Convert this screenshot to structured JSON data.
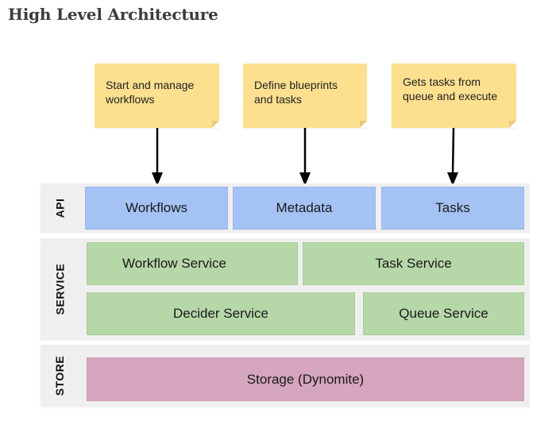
{
  "title": "High Level Architecture",
  "notes": [
    {
      "line1": "Start and manage",
      "line2": "workflows"
    },
    {
      "line1": "Define blueprints",
      "line2": "and tasks"
    },
    {
      "line1": "Gets tasks from",
      "line2": "queue and execute"
    }
  ],
  "layers": {
    "api": {
      "label": "API",
      "boxes": [
        "Workflows",
        "Metadata",
        "Tasks"
      ]
    },
    "service": {
      "label": "SERVICE",
      "boxes": [
        "Workflow Service",
        "Task Service",
        "Decider Service",
        "Queue Service"
      ]
    },
    "store": {
      "label": "STORE",
      "boxes": [
        "Storage (Dynomite)"
      ]
    }
  },
  "colors": {
    "note": "#fce08f",
    "api": "#a4c2f4",
    "service": "#b6d7a8",
    "store": "#d5a6bd",
    "band": "#efefef"
  }
}
